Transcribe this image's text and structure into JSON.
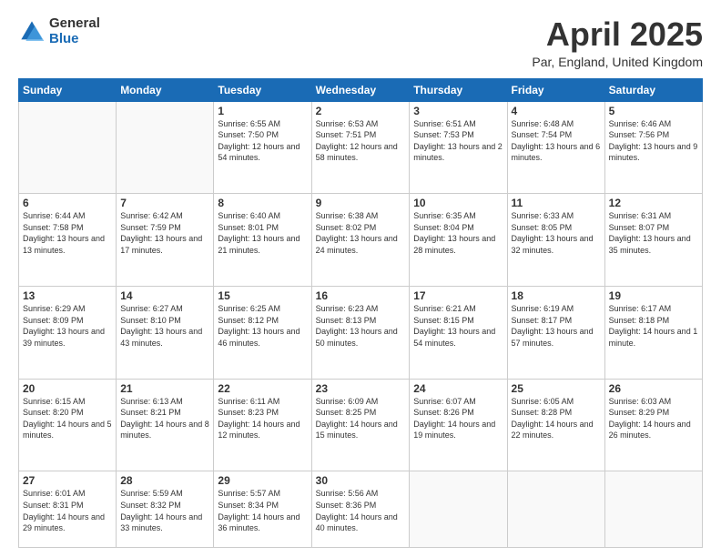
{
  "logo": {
    "general": "General",
    "blue": "Blue",
    "icon": "▶"
  },
  "title": {
    "month": "April 2025",
    "location": "Par, England, United Kingdom"
  },
  "days_of_week": [
    "Sunday",
    "Monday",
    "Tuesday",
    "Wednesday",
    "Thursday",
    "Friday",
    "Saturday"
  ],
  "weeks": [
    [
      {
        "day": "",
        "detail": ""
      },
      {
        "day": "",
        "detail": ""
      },
      {
        "day": "1",
        "detail": "Sunrise: 6:55 AM\nSunset: 7:50 PM\nDaylight: 12 hours\nand 54 minutes."
      },
      {
        "day": "2",
        "detail": "Sunrise: 6:53 AM\nSunset: 7:51 PM\nDaylight: 12 hours\nand 58 minutes."
      },
      {
        "day": "3",
        "detail": "Sunrise: 6:51 AM\nSunset: 7:53 PM\nDaylight: 13 hours\nand 2 minutes."
      },
      {
        "day": "4",
        "detail": "Sunrise: 6:48 AM\nSunset: 7:54 PM\nDaylight: 13 hours\nand 6 minutes."
      },
      {
        "day": "5",
        "detail": "Sunrise: 6:46 AM\nSunset: 7:56 PM\nDaylight: 13 hours\nand 9 minutes."
      }
    ],
    [
      {
        "day": "6",
        "detail": "Sunrise: 6:44 AM\nSunset: 7:58 PM\nDaylight: 13 hours\nand 13 minutes."
      },
      {
        "day": "7",
        "detail": "Sunrise: 6:42 AM\nSunset: 7:59 PM\nDaylight: 13 hours\nand 17 minutes."
      },
      {
        "day": "8",
        "detail": "Sunrise: 6:40 AM\nSunset: 8:01 PM\nDaylight: 13 hours\nand 21 minutes."
      },
      {
        "day": "9",
        "detail": "Sunrise: 6:38 AM\nSunset: 8:02 PM\nDaylight: 13 hours\nand 24 minutes."
      },
      {
        "day": "10",
        "detail": "Sunrise: 6:35 AM\nSunset: 8:04 PM\nDaylight: 13 hours\nand 28 minutes."
      },
      {
        "day": "11",
        "detail": "Sunrise: 6:33 AM\nSunset: 8:05 PM\nDaylight: 13 hours\nand 32 minutes."
      },
      {
        "day": "12",
        "detail": "Sunrise: 6:31 AM\nSunset: 8:07 PM\nDaylight: 13 hours\nand 35 minutes."
      }
    ],
    [
      {
        "day": "13",
        "detail": "Sunrise: 6:29 AM\nSunset: 8:09 PM\nDaylight: 13 hours\nand 39 minutes."
      },
      {
        "day": "14",
        "detail": "Sunrise: 6:27 AM\nSunset: 8:10 PM\nDaylight: 13 hours\nand 43 minutes."
      },
      {
        "day": "15",
        "detail": "Sunrise: 6:25 AM\nSunset: 8:12 PM\nDaylight: 13 hours\nand 46 minutes."
      },
      {
        "day": "16",
        "detail": "Sunrise: 6:23 AM\nSunset: 8:13 PM\nDaylight: 13 hours\nand 50 minutes."
      },
      {
        "day": "17",
        "detail": "Sunrise: 6:21 AM\nSunset: 8:15 PM\nDaylight: 13 hours\nand 54 minutes."
      },
      {
        "day": "18",
        "detail": "Sunrise: 6:19 AM\nSunset: 8:17 PM\nDaylight: 13 hours\nand 57 minutes."
      },
      {
        "day": "19",
        "detail": "Sunrise: 6:17 AM\nSunset: 8:18 PM\nDaylight: 14 hours\nand 1 minute."
      }
    ],
    [
      {
        "day": "20",
        "detail": "Sunrise: 6:15 AM\nSunset: 8:20 PM\nDaylight: 14 hours\nand 5 minutes."
      },
      {
        "day": "21",
        "detail": "Sunrise: 6:13 AM\nSunset: 8:21 PM\nDaylight: 14 hours\nand 8 minutes."
      },
      {
        "day": "22",
        "detail": "Sunrise: 6:11 AM\nSunset: 8:23 PM\nDaylight: 14 hours\nand 12 minutes."
      },
      {
        "day": "23",
        "detail": "Sunrise: 6:09 AM\nSunset: 8:25 PM\nDaylight: 14 hours\nand 15 minutes."
      },
      {
        "day": "24",
        "detail": "Sunrise: 6:07 AM\nSunset: 8:26 PM\nDaylight: 14 hours\nand 19 minutes."
      },
      {
        "day": "25",
        "detail": "Sunrise: 6:05 AM\nSunset: 8:28 PM\nDaylight: 14 hours\nand 22 minutes."
      },
      {
        "day": "26",
        "detail": "Sunrise: 6:03 AM\nSunset: 8:29 PM\nDaylight: 14 hours\nand 26 minutes."
      }
    ],
    [
      {
        "day": "27",
        "detail": "Sunrise: 6:01 AM\nSunset: 8:31 PM\nDaylight: 14 hours\nand 29 minutes."
      },
      {
        "day": "28",
        "detail": "Sunrise: 5:59 AM\nSunset: 8:32 PM\nDaylight: 14 hours\nand 33 minutes."
      },
      {
        "day": "29",
        "detail": "Sunrise: 5:57 AM\nSunset: 8:34 PM\nDaylight: 14 hours\nand 36 minutes."
      },
      {
        "day": "30",
        "detail": "Sunrise: 5:56 AM\nSunset: 8:36 PM\nDaylight: 14 hours\nand 40 minutes."
      },
      {
        "day": "",
        "detail": ""
      },
      {
        "day": "",
        "detail": ""
      },
      {
        "day": "",
        "detail": ""
      }
    ]
  ]
}
